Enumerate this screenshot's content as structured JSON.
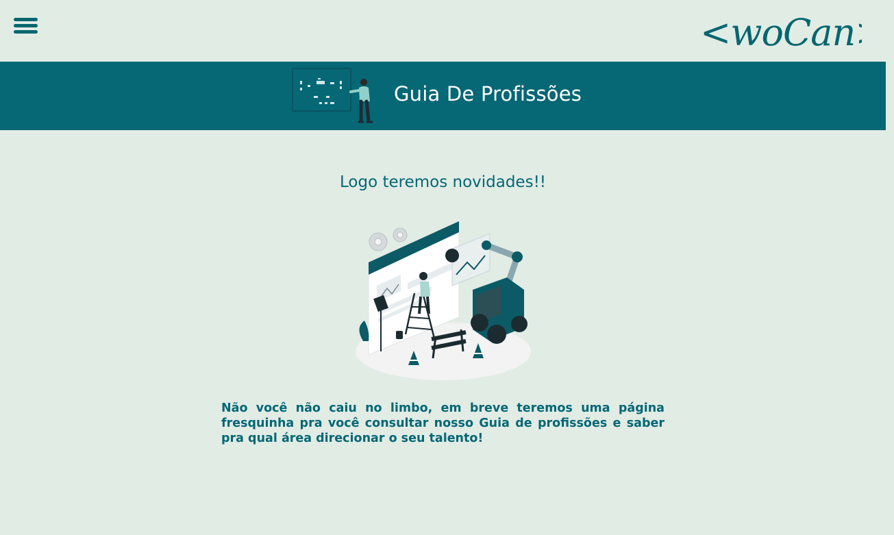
{
  "header": {
    "menu_icon": "hamburger-menu-icon",
    "logo_text": "<woCan>"
  },
  "banner": {
    "title": "Guia De Profissões",
    "illustration": "person-with-board-illustration"
  },
  "main": {
    "headline": "Logo teremos novidades!!",
    "illustration": "website-under-construction-illustration",
    "message": "Não você não caiu no limbo, em breve teremos uma página fresquinha pra você consultar nosso Guia de profissões e saber pra qual área direcionar o seu talento!"
  },
  "colors": {
    "background": "#e1ece5",
    "accent": "#066775",
    "text_on_accent": "#ffffff"
  }
}
